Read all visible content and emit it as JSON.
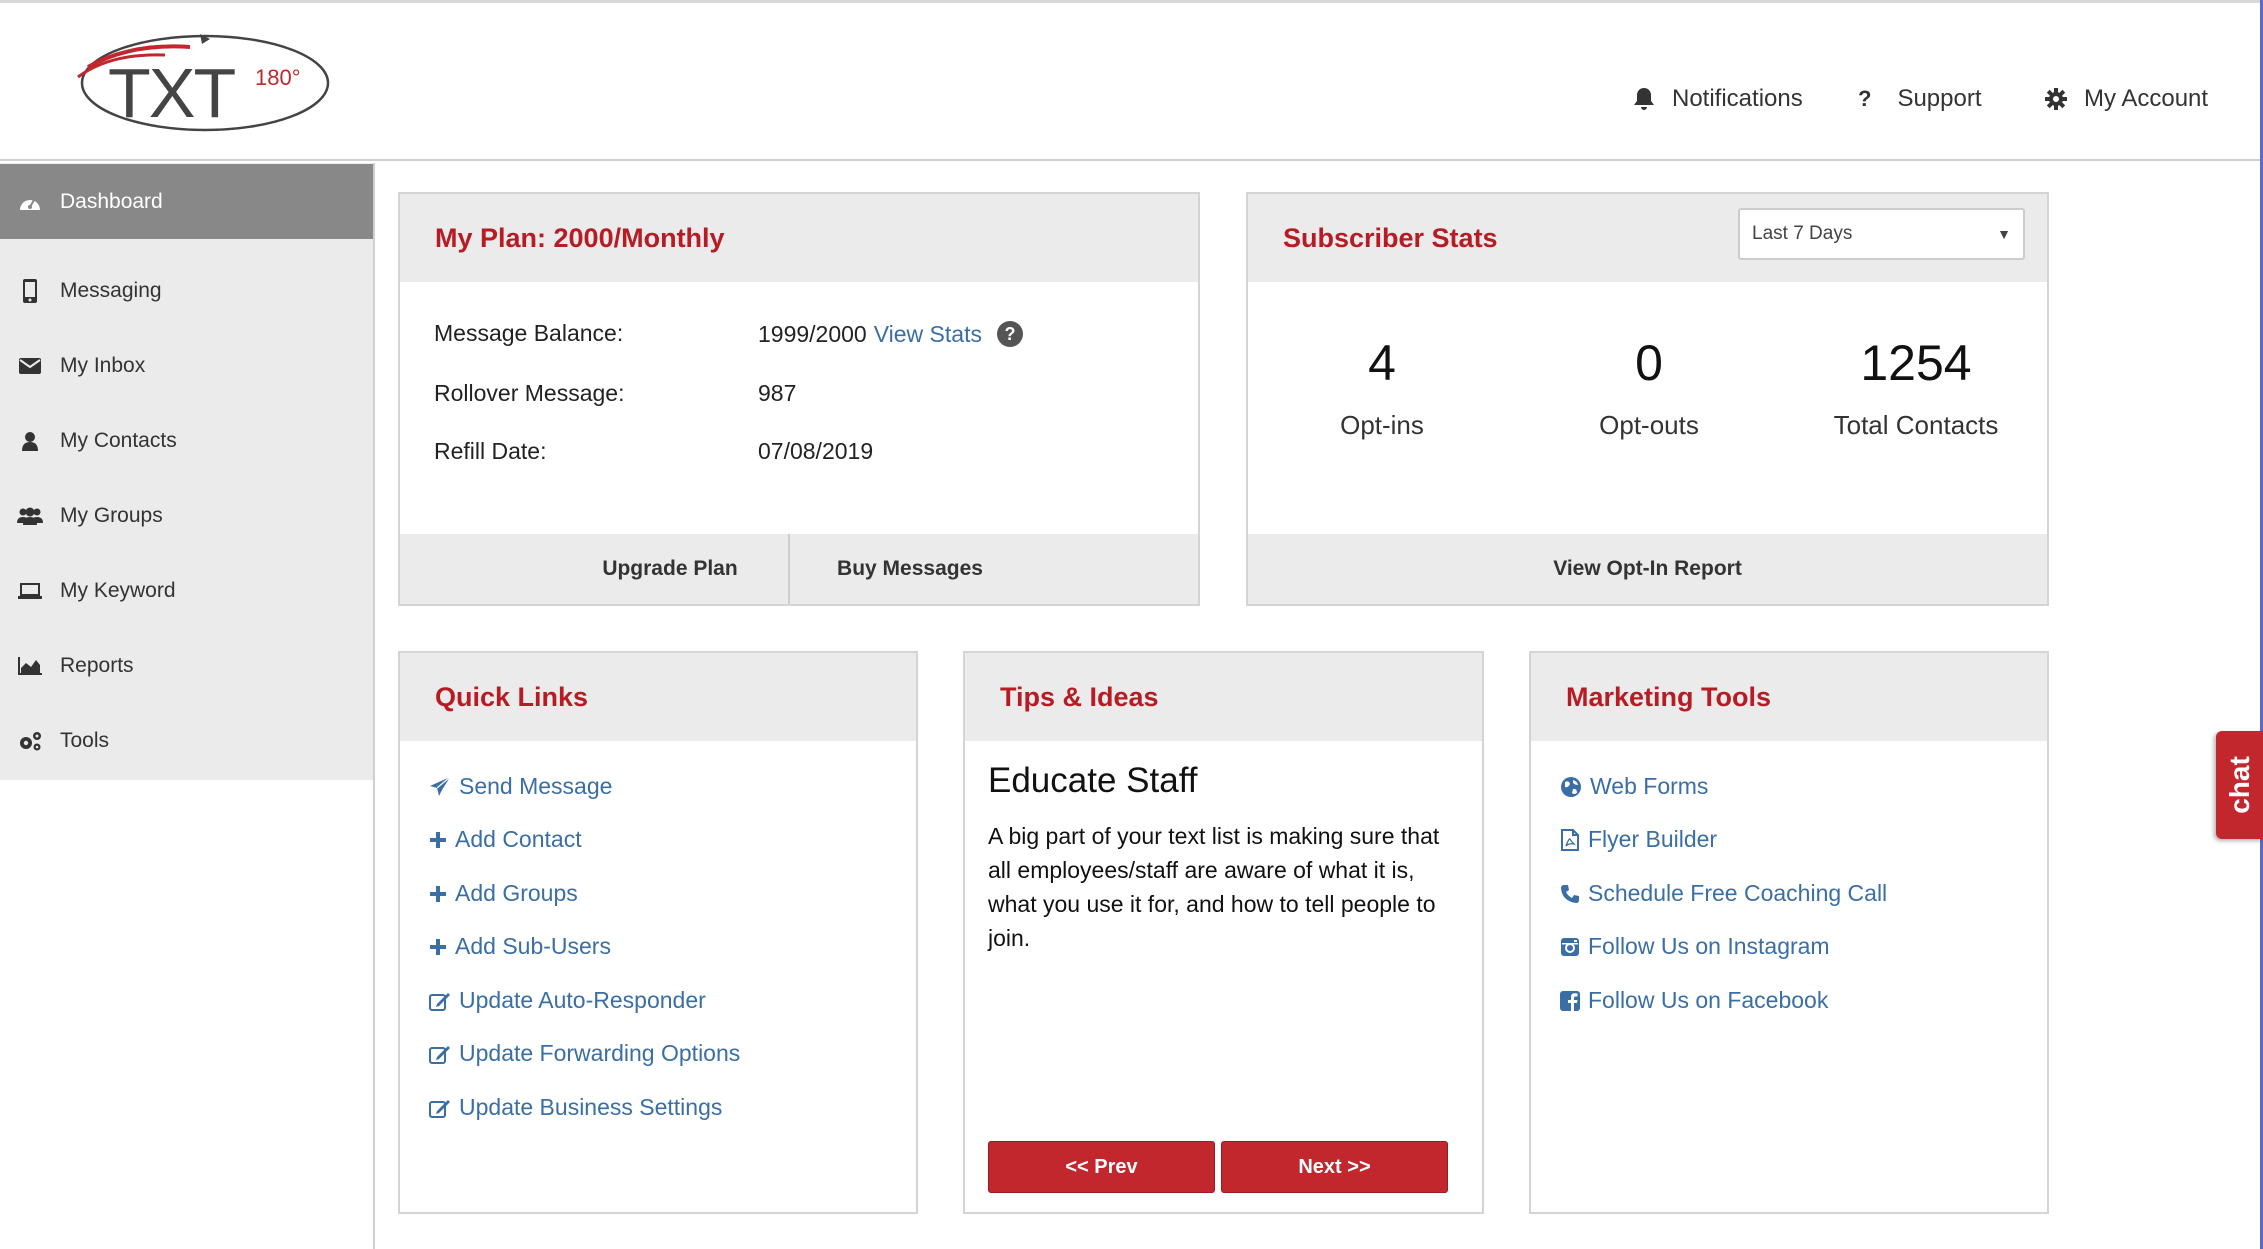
{
  "header": {
    "logo": {
      "main": "TXT",
      "superscript": "180°"
    },
    "nav": [
      {
        "label": "Notifications",
        "icon": "bell-icon"
      },
      {
        "label": "Support",
        "icon": "question-icon"
      },
      {
        "label": "My Account",
        "icon": "gear-icon"
      }
    ]
  },
  "sidebar": {
    "items": [
      {
        "label": "Dashboard",
        "icon": "dashboard-icon",
        "active": true
      },
      {
        "label": "Messaging",
        "icon": "mobile-icon"
      },
      {
        "label": "My Inbox",
        "icon": "envelope-icon"
      },
      {
        "label": "My Contacts",
        "icon": "user-icon"
      },
      {
        "label": "My Groups",
        "icon": "users-icon"
      },
      {
        "label": "My Keyword",
        "icon": "laptop-icon"
      },
      {
        "label": "Reports",
        "icon": "area-chart-icon"
      },
      {
        "label": "Tools",
        "icon": "cogs-icon"
      }
    ]
  },
  "plan": {
    "title": "My Plan: 2000/Monthly",
    "rows": [
      {
        "label": "Message Balance:",
        "value": "1999/2000",
        "link": "View Stats"
      },
      {
        "label": "Rollover Message:",
        "value": "987"
      },
      {
        "label": "Refill Date:",
        "value": "07/08/2019"
      }
    ],
    "buttons": {
      "upgrade": "Upgrade Plan",
      "buy": "Buy Messages"
    }
  },
  "stats": {
    "title": "Subscriber Stats",
    "range_selected": "Last 7 Days",
    "items": [
      {
        "value": "4",
        "label": "Opt-ins"
      },
      {
        "value": "0",
        "label": "Opt-outs"
      },
      {
        "value": "1254",
        "label": "Total Contacts"
      }
    ],
    "report_button": "View Opt-In Report"
  },
  "quick_links": {
    "title": "Quick Links",
    "items": [
      {
        "label": "Send Message",
        "icon": "paper-plane-icon"
      },
      {
        "label": "Add Contact",
        "icon": "plus-icon"
      },
      {
        "label": "Add Groups",
        "icon": "plus-icon"
      },
      {
        "label": "Add Sub-Users",
        "icon": "plus-icon"
      },
      {
        "label": "Update Auto-Responder",
        "icon": "edit-icon"
      },
      {
        "label": "Update Forwarding Options",
        "icon": "edit-icon"
      },
      {
        "label": "Update Business Settings",
        "icon": "edit-icon"
      }
    ]
  },
  "tips": {
    "title": "Tips & Ideas",
    "heading": "Educate Staff",
    "body": "A big part of your text list is making sure that all employees/staff are aware of what it is, what you use it for, and how to tell people to join.",
    "prev": "<< Prev",
    "next": "Next >>"
  },
  "marketing": {
    "title": "Marketing Tools",
    "items": [
      {
        "label": "Web Forms",
        "icon": "globe-icon"
      },
      {
        "label": "Flyer Builder",
        "icon": "pdf-file-icon"
      },
      {
        "label": "Schedule Free Coaching Call",
        "icon": "phone-icon"
      },
      {
        "label": "Follow Us on Instagram",
        "icon": "instagram-icon"
      },
      {
        "label": "Follow Us on Facebook",
        "icon": "facebook-icon"
      }
    ]
  },
  "chat_tab": "chat",
  "colors": {
    "brand_red": "#b71c25",
    "link_blue": "#3a6ea5",
    "active_sidebar": "#888888",
    "panel_header": "#ebebeb"
  }
}
